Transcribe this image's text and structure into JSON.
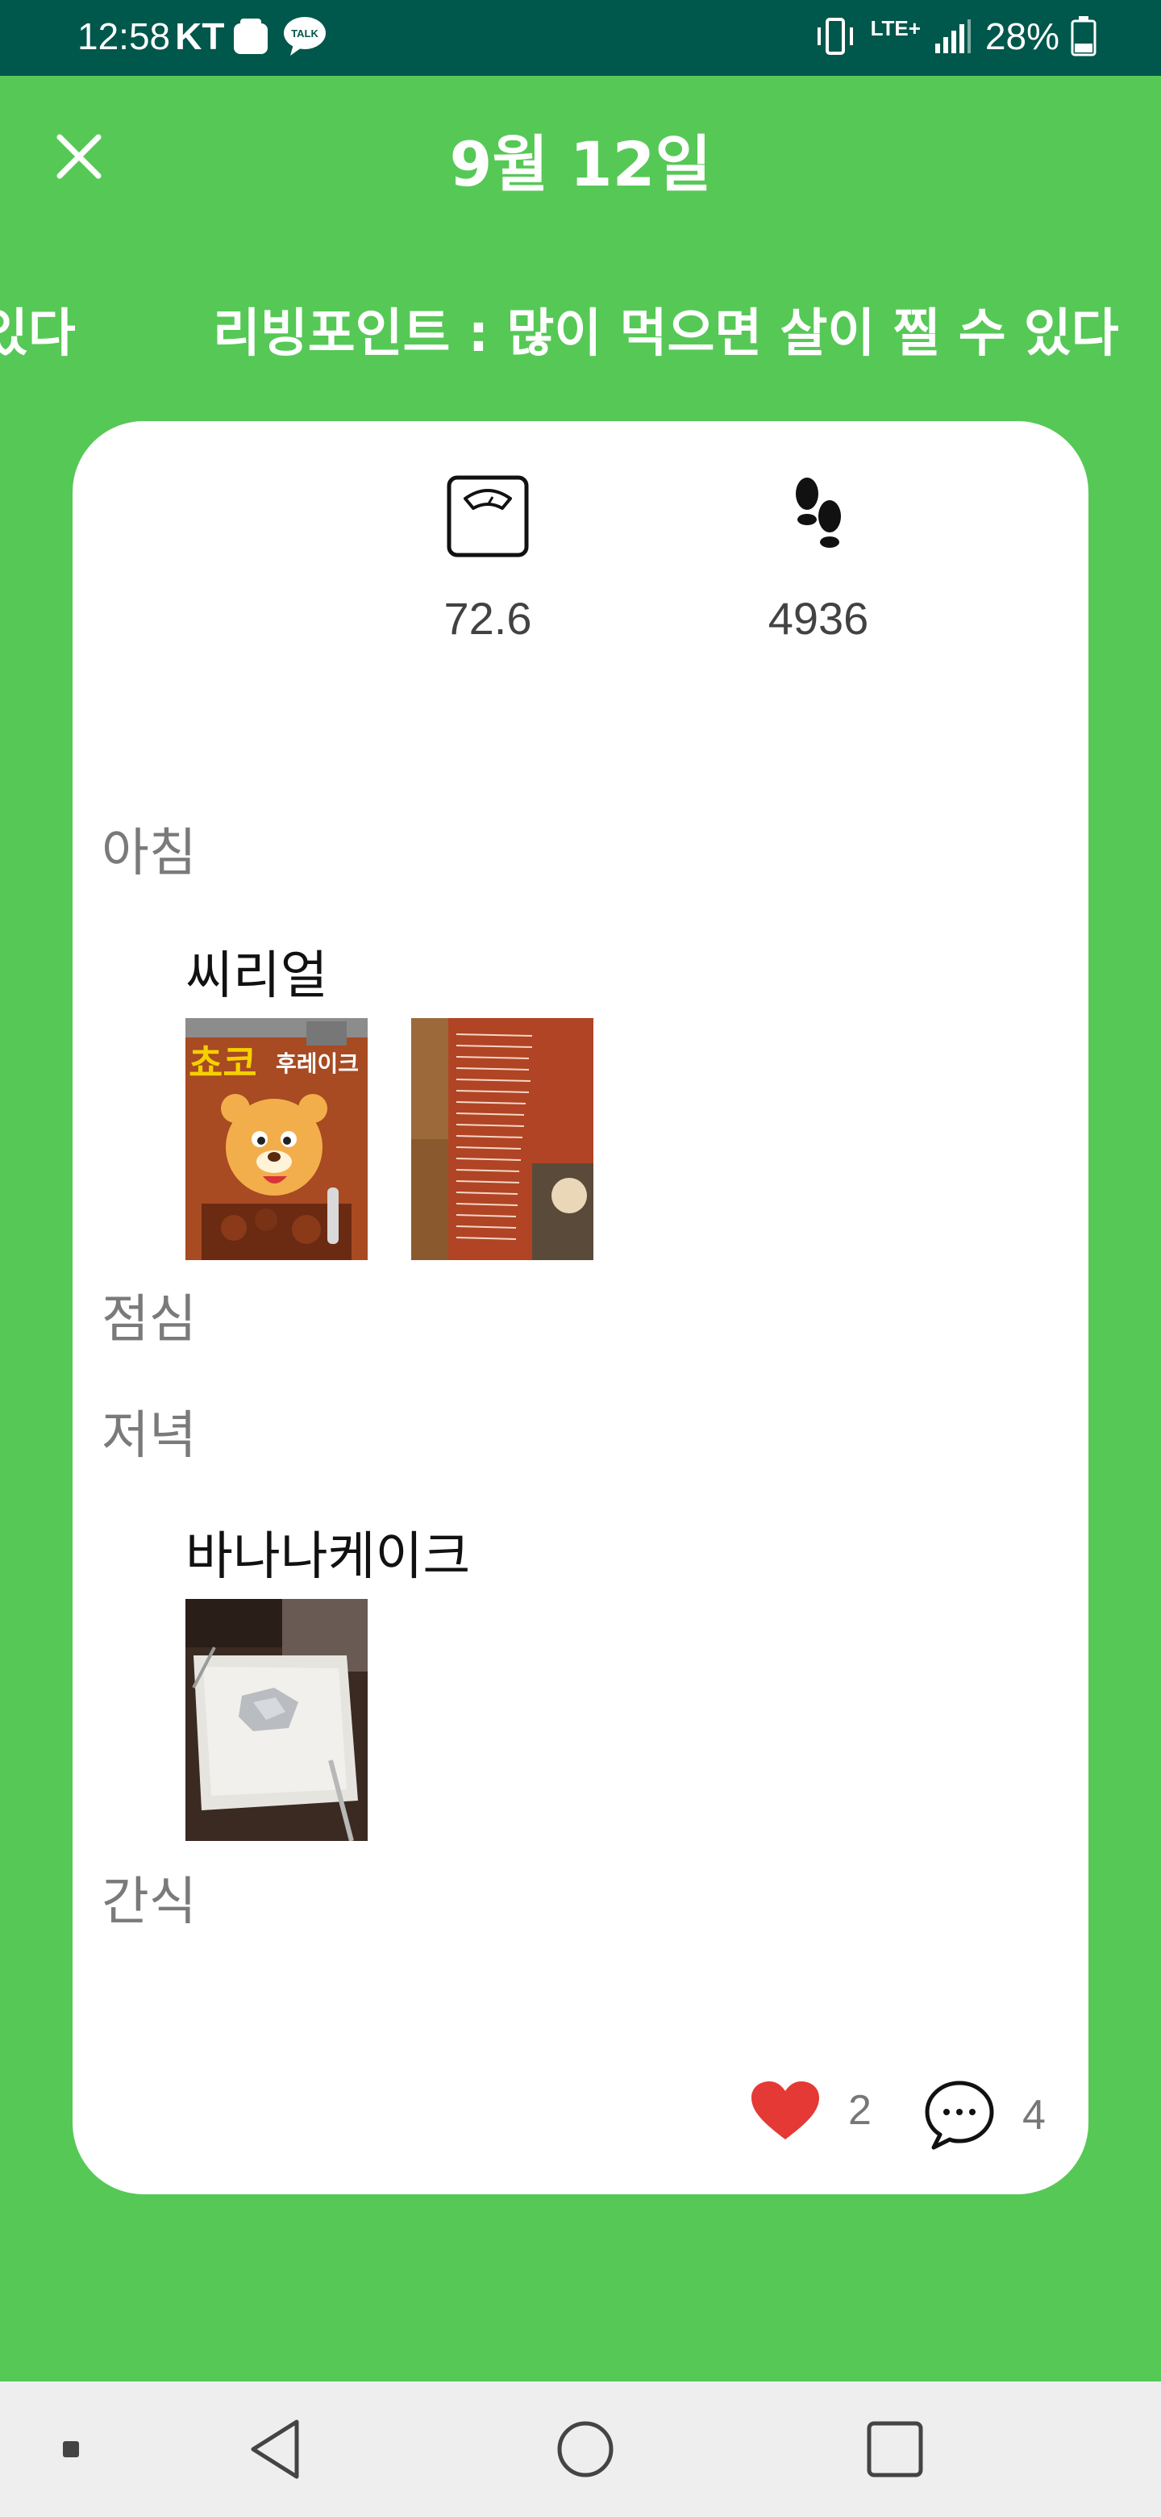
{
  "status_bar": {
    "time": "12:58",
    "carrier": "KT",
    "talk_badge": "TALK",
    "network": "LTE+",
    "battery": "28%",
    "background_color": "#00574b"
  },
  "header": {
    "title": "9월 12일",
    "close_icon": "close-icon",
    "background_color": "#56c856"
  },
  "ticker": {
    "prev_fragment": "있다",
    "text": "리빙포인트 : 많이 먹으면 살이 찔 수 있다"
  },
  "stats": {
    "weight": {
      "icon": "scale-icon",
      "value": "72.6"
    },
    "steps": {
      "icon": "footsteps-icon",
      "value": "4936"
    }
  },
  "meals": [
    {
      "label": "아침",
      "items": [
        {
          "name": "씨리얼",
          "photos": [
            "cereal-box-front",
            "cereal-box-nutrition-label"
          ]
        }
      ]
    },
    {
      "label": "점심",
      "items": []
    },
    {
      "label": "저녁",
      "items": [
        {
          "name": "바나나케이크",
          "photos": [
            "plate-with-foil"
          ]
        }
      ]
    },
    {
      "label": "간식",
      "items": []
    }
  ],
  "cereal_box_text": {
    "brand": "쵸코",
    "product": "후레이크"
  },
  "footer": {
    "likes": "2",
    "comments": "4",
    "heart_color": "#e53935"
  },
  "navbar": {
    "buttons": [
      "dot-icon",
      "back-icon",
      "home-icon",
      "recents-icon"
    ]
  }
}
